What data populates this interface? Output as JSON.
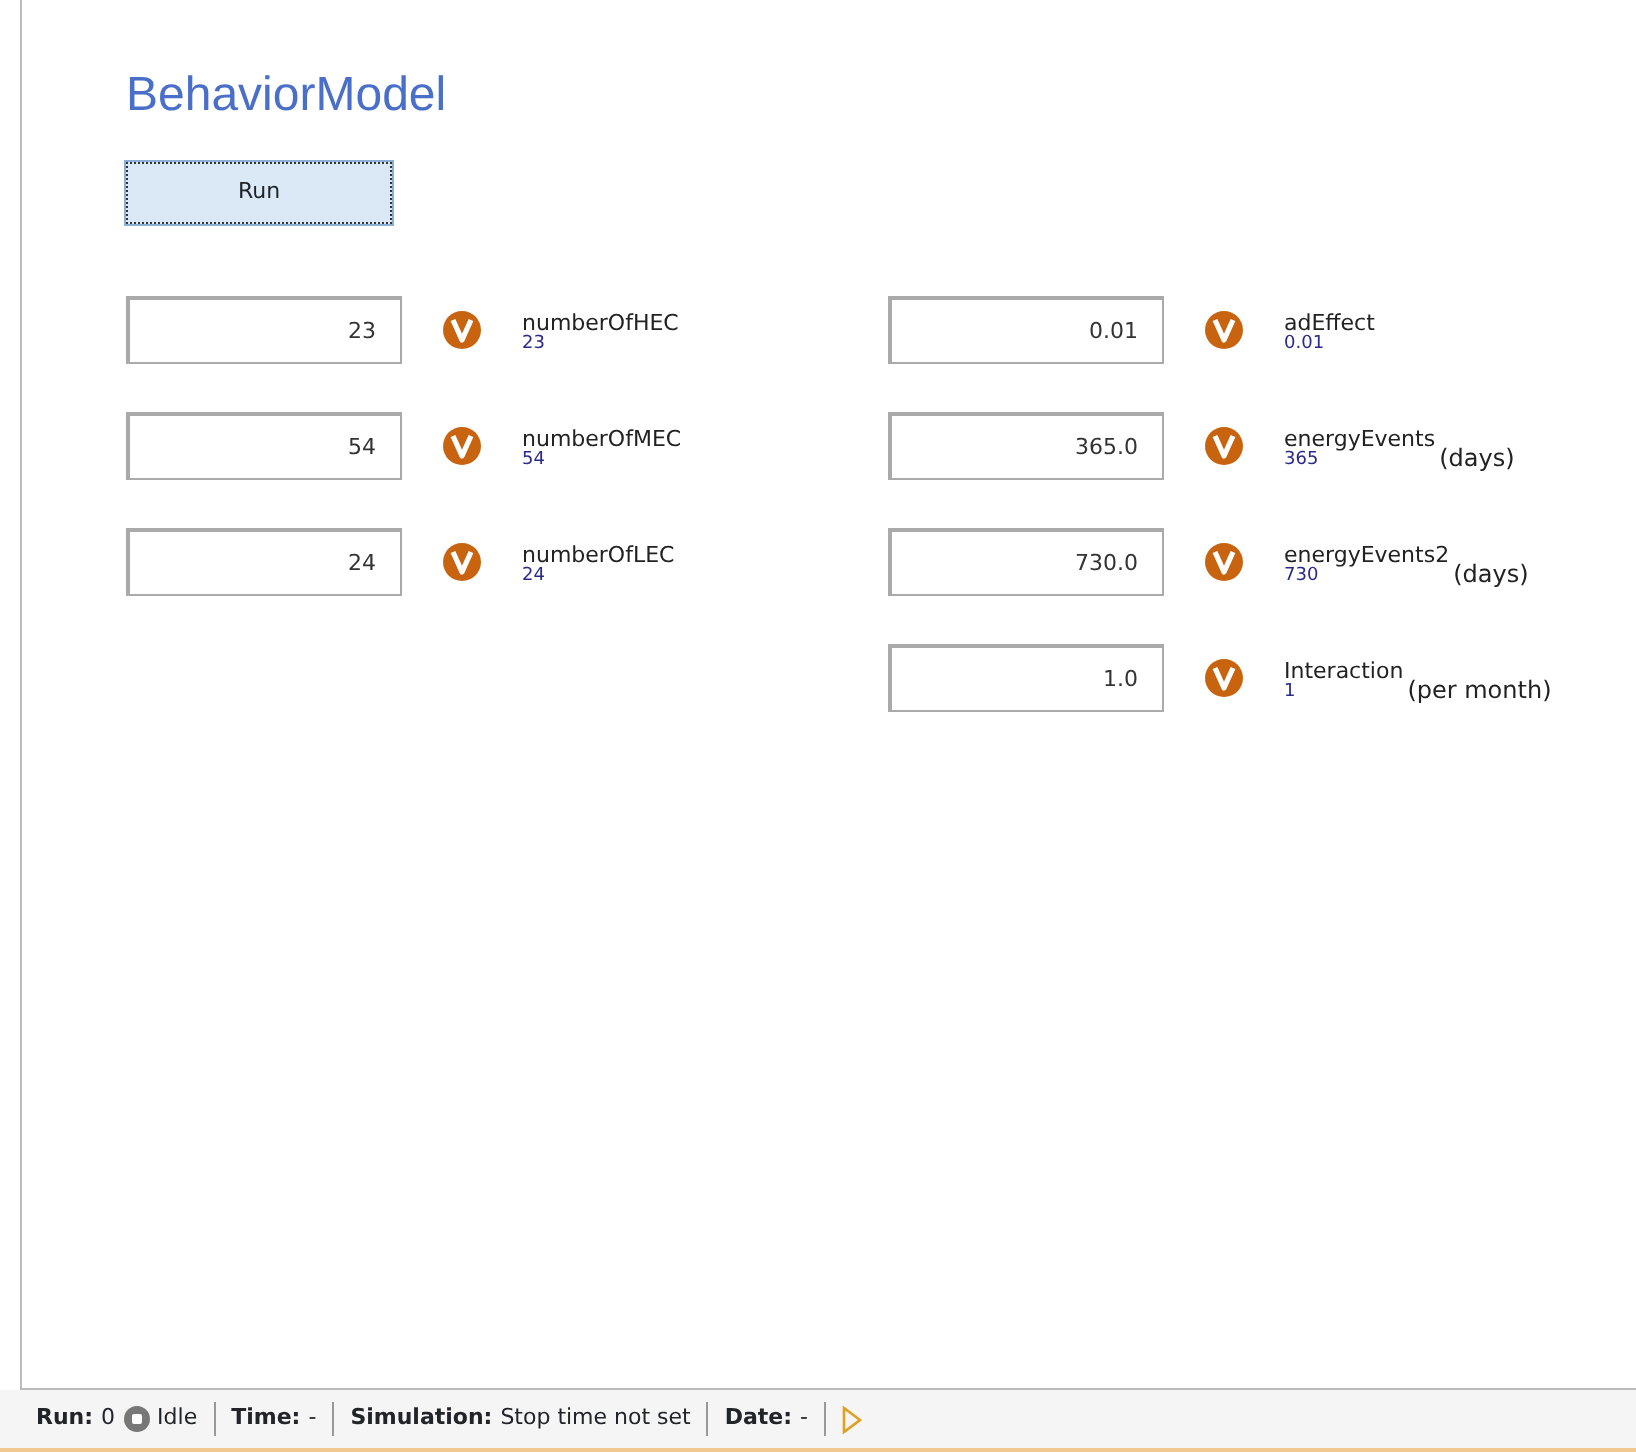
{
  "title": "BehaviorModel",
  "run_button": "Run",
  "columns": [
    [
      {
        "field": "23",
        "name": "numberOfHEC",
        "current": "23"
      },
      {
        "field": "54",
        "name": "numberOfMEC",
        "current": "54"
      },
      {
        "field": "24",
        "name": "numberOfLEC",
        "current": "24"
      }
    ],
    [
      {
        "field": "0.01",
        "name": "adEffect",
        "current": "0.01"
      },
      {
        "field": "365.0",
        "name": "energyEvents",
        "current": "365",
        "unit": "(days)"
      },
      {
        "field": "730.0",
        "name": "energyEvents2",
        "current": "730",
        "unit": "(days)"
      },
      {
        "field": "1.0",
        "name": "Interaction",
        "current": "1",
        "unit": "(per month)"
      }
    ]
  ],
  "status_bar": [
    {
      "kind": "run",
      "label": "Run:",
      "value": "0",
      "state": "Idle"
    },
    {
      "kind": "text",
      "label": "Time:",
      "value": "-"
    },
    {
      "kind": "text",
      "label": "Simulation:",
      "value": "Stop time not set"
    },
    {
      "kind": "text",
      "label": "Date:",
      "value": "-"
    },
    {
      "kind": "play"
    }
  ]
}
